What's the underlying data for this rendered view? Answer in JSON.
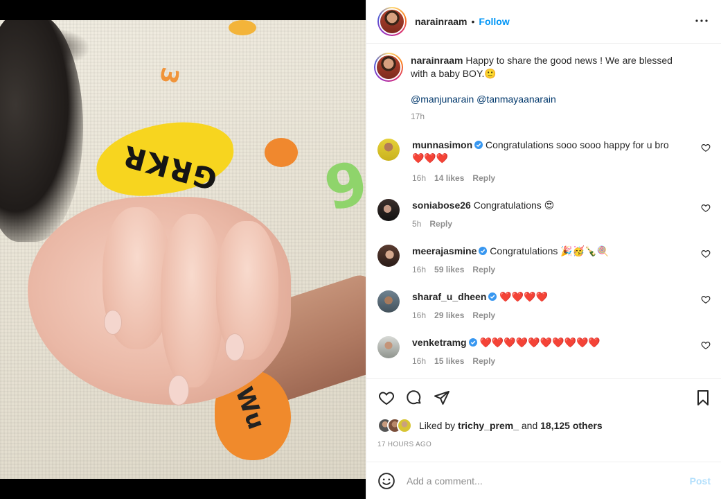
{
  "post": {
    "username": "narainraam",
    "follow_label": "Follow",
    "dot": "•",
    "caption": {
      "username": "narainraam",
      "text": "Happy to share the good news ! We are blessed with a baby BOY.🙂",
      "mentions": [
        "@manjunarain",
        "@tanmayaanarain"
      ],
      "age": "17h"
    },
    "image_alt": "Baby's hand holding a finger"
  },
  "photo_prints": {
    "grkr": "GRKR",
    "nine": "9",
    "three": "3",
    "orange": "Wu"
  },
  "comments": [
    {
      "username": "munnasimon",
      "verified": true,
      "text": "Congratulations sooo sooo happy for u bro",
      "hearts": "❤️❤️❤️",
      "age": "16h",
      "likes": "14 likes",
      "reply": "Reply"
    },
    {
      "username": "soniabose26",
      "verified": false,
      "text": "Congratulations 😍",
      "age": "5h",
      "reply": "Reply"
    },
    {
      "username": "meerajasmine",
      "verified": true,
      "text": "Congratulations 🎉🥳🍾🍭",
      "age": "16h",
      "likes": "59 likes",
      "reply": "Reply"
    },
    {
      "username": "sharaf_u_dheen",
      "verified": true,
      "text": "❤️❤️❤️❤️",
      "age": "16h",
      "likes": "29 likes",
      "reply": "Reply"
    },
    {
      "username": "venketramg",
      "verified": true,
      "text": "❤️❤️❤️❤️❤️❤️❤️❤️❤️❤️",
      "age": "16h",
      "likes": "15 likes",
      "reply": "Reply"
    }
  ],
  "likes": {
    "prefix": "Liked by",
    "user": "trichy_prem_",
    "conj": "and",
    "others": "18,125 others"
  },
  "timestamp": "17 HOURS AGO",
  "add_comment": {
    "placeholder": "Add a comment...",
    "post_label": "Post"
  },
  "colors": {
    "accent": "#0095f6",
    "heart": "#e0245e",
    "muted": "#8e8e8e",
    "post_disabled": "#b2dffc"
  },
  "icons": [
    "more-options-icon",
    "verified-badge-icon",
    "heart-icon",
    "comment-icon",
    "share-icon",
    "bookmark-icon",
    "emoji-icon"
  ]
}
